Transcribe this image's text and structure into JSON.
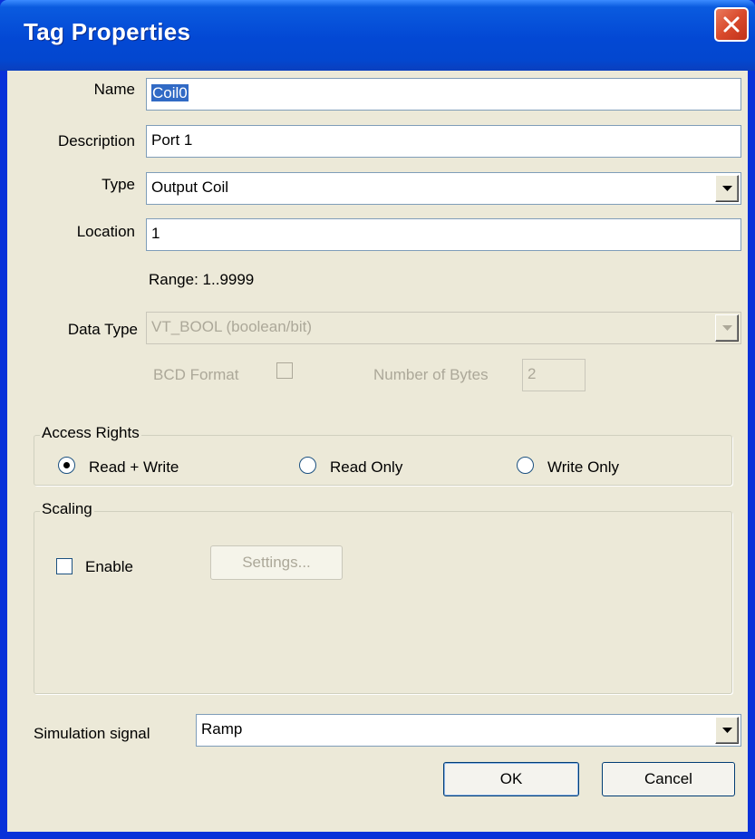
{
  "window": {
    "title": "Tag Properties"
  },
  "name": {
    "label": "Name",
    "value": "Coil0"
  },
  "description": {
    "label": "Description",
    "value": "Port 1"
  },
  "type": {
    "label": "Type",
    "value": "Output Coil"
  },
  "location": {
    "label": "Location",
    "value": "1",
    "range_text": "Range: 1..9999"
  },
  "data_type": {
    "label": "Data Type",
    "value": "VT_BOOL (boolean/bit)",
    "enabled": false
  },
  "bcd": {
    "label": "BCD Format",
    "checked": false,
    "enabled": false
  },
  "bytes": {
    "label": "Number of Bytes",
    "value": "2",
    "enabled": false
  },
  "access": {
    "title": "Access Rights",
    "options": [
      {
        "label": "Read + Write",
        "selected": true
      },
      {
        "label": "Read Only",
        "selected": false
      },
      {
        "label": "Write Only",
        "selected": false
      }
    ]
  },
  "scaling": {
    "title": "Scaling",
    "enable_label": "Enable",
    "enabled": false,
    "settings_label": "Settings..."
  },
  "simulation": {
    "label": "Simulation signal",
    "value": "Ramp"
  },
  "buttons": {
    "ok": "OK",
    "cancel": "Cancel"
  },
  "colors": {
    "title_bar": "#0348d4",
    "dialog_bg": "#ece9d8",
    "close_button": "#d94a2c",
    "selection": "#316ac5"
  }
}
